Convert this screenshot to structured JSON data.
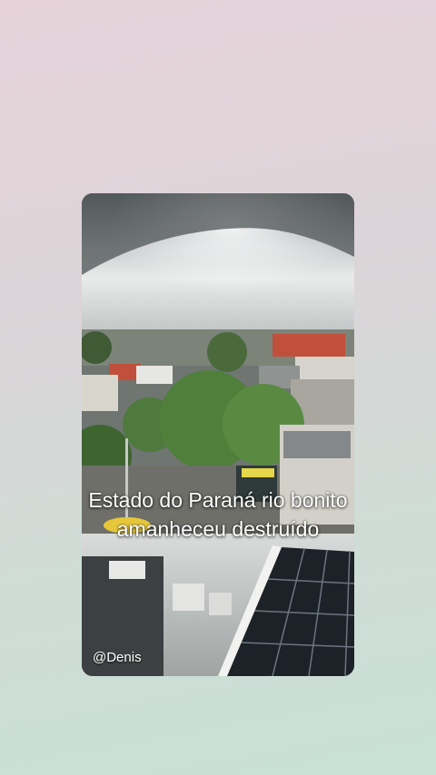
{
  "video": {
    "caption": "Estado do Paraná rio bonito amanheceu destruído",
    "watermark": "@Denis"
  },
  "colors": {
    "background_top": "#e6d3da",
    "background_bottom": "#c8e0d6",
    "caption_text": "#ffffff"
  }
}
